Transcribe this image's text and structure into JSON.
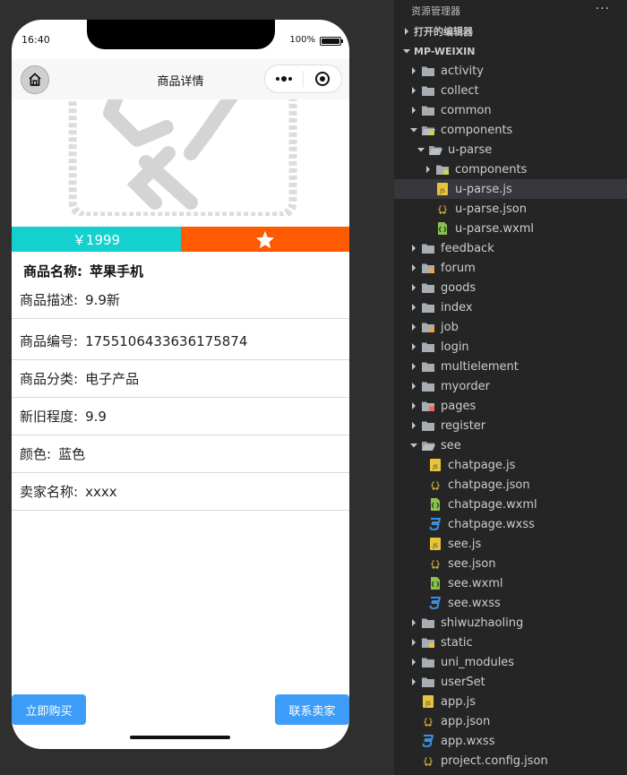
{
  "phone": {
    "time": "16:40",
    "battery": "100%",
    "battery_level": 1.0,
    "nav_title": "商品详情",
    "price": "￥1999",
    "product_name_label": "商品名称:",
    "product_name": "苹果手机",
    "details": [
      {
        "label": "商品描述:",
        "value": "9.9新"
      },
      {
        "label": "商品编号:",
        "value": "1755106433636175874"
      },
      {
        "label": "商品分类:",
        "value": "电子产品"
      },
      {
        "label": "新旧程度:",
        "value": "9.9"
      },
      {
        "label": "颜色:",
        "value": "蓝色"
      },
      {
        "label": "卖家名称:",
        "value": "xxxx"
      }
    ],
    "buy_button": "立即购买",
    "contact_button": "联系卖家",
    "colors": {
      "price_bg": "#14d1cf",
      "fav_bg": "#fd5a01",
      "button": "#3d9df8"
    }
  },
  "explorer": {
    "title": "资源管理器",
    "more": "···",
    "sections": {
      "open_editors": "打开的编辑器",
      "project": "MP-WEIXIN"
    },
    "tree": [
      {
        "name": "activity",
        "kind": "folder",
        "icon": "folder-icon"
      },
      {
        "name": "collect",
        "kind": "folder",
        "icon": "folder-icon"
      },
      {
        "name": "common",
        "kind": "folder",
        "icon": "folder-icon"
      },
      {
        "name": "components",
        "kind": "folder-open",
        "icon": "components-folder-open-icon"
      },
      {
        "name": "u-parse",
        "kind": "folder-open",
        "icon": "folder-open-icon"
      },
      {
        "name": "components",
        "kind": "folder",
        "icon": "components-folder-icon"
      },
      {
        "name": "u-parse.js",
        "kind": "file",
        "icon": "js-file-icon",
        "selected": true
      },
      {
        "name": "u-parse.json",
        "kind": "file",
        "icon": "json-file-icon"
      },
      {
        "name": "u-parse.wxml",
        "kind": "file",
        "icon": "wxml-file-icon"
      },
      {
        "name": "feedback",
        "kind": "folder",
        "icon": "folder-icon"
      },
      {
        "name": "forum",
        "kind": "folder",
        "icon": "forum-folder-icon"
      },
      {
        "name": "goods",
        "kind": "folder",
        "icon": "folder-icon"
      },
      {
        "name": "index",
        "kind": "folder",
        "icon": "folder-icon"
      },
      {
        "name": "job",
        "kind": "folder",
        "icon": "job-folder-icon"
      },
      {
        "name": "login",
        "kind": "folder",
        "icon": "folder-icon"
      },
      {
        "name": "multielement",
        "kind": "folder",
        "icon": "folder-icon"
      },
      {
        "name": "myorder",
        "kind": "folder",
        "icon": "folder-icon"
      },
      {
        "name": "pages",
        "kind": "folder",
        "icon": "pages-folder-icon"
      },
      {
        "name": "register",
        "kind": "folder",
        "icon": "folder-icon"
      },
      {
        "name": "see",
        "kind": "folder-open",
        "icon": "folder-open-icon"
      },
      {
        "name": "chatpage.js",
        "kind": "file",
        "icon": "js-file-icon"
      },
      {
        "name": "chatpage.json",
        "kind": "file",
        "icon": "json-file-icon"
      },
      {
        "name": "chatpage.wxml",
        "kind": "file",
        "icon": "wxml-file-icon"
      },
      {
        "name": "chatpage.wxss",
        "kind": "file",
        "icon": "wxss-file-icon"
      },
      {
        "name": "see.js",
        "kind": "file",
        "icon": "js-file-icon"
      },
      {
        "name": "see.json",
        "kind": "file",
        "icon": "json-file-icon"
      },
      {
        "name": "see.wxml",
        "kind": "file",
        "icon": "wxml-file-icon"
      },
      {
        "name": "see.wxss",
        "kind": "file",
        "icon": "wxss-file-icon"
      },
      {
        "name": "shiwuzhaoling",
        "kind": "folder",
        "icon": "folder-icon"
      },
      {
        "name": "static",
        "kind": "folder",
        "icon": "static-folder-icon"
      },
      {
        "name": "uni_modules",
        "kind": "folder",
        "icon": "folder-icon"
      },
      {
        "name": "userSet",
        "kind": "folder",
        "icon": "folder-icon"
      },
      {
        "name": "app.js",
        "kind": "file",
        "icon": "js-file-icon"
      },
      {
        "name": "app.json",
        "kind": "file",
        "icon": "json-file-icon"
      },
      {
        "name": "app.wxss",
        "kind": "file",
        "icon": "wxss-file-icon"
      },
      {
        "name": "project.config.json",
        "kind": "file",
        "icon": "json-file-icon"
      }
    ],
    "colors": {
      "background": "#252526",
      "selected": "#37373d",
      "js": "#e8c43b",
      "json": "#e8c43b",
      "wxml": "#8cc152",
      "wxss": "#3d8fe0"
    }
  }
}
